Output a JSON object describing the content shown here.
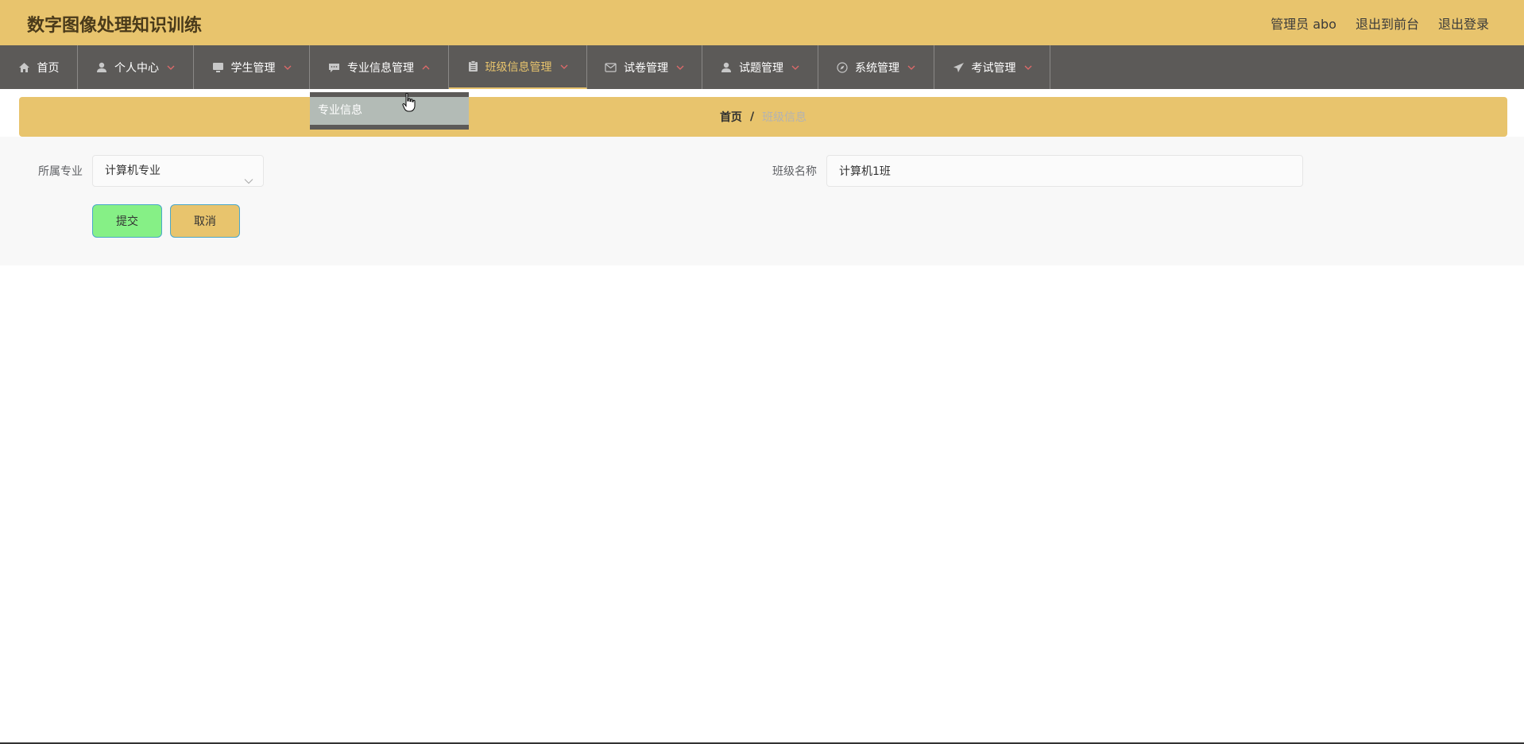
{
  "header": {
    "title": "数字图像处理知识训练",
    "links": [
      "管理员 abo",
      "退出到前台",
      "退出登录"
    ]
  },
  "nav": {
    "items": [
      {
        "label": "首页",
        "icon": "home-icon",
        "has_chevron": false
      },
      {
        "label": "个人中心",
        "icon": "user-icon",
        "has_chevron": true
      },
      {
        "label": "学生管理",
        "icon": "monitor-icon",
        "has_chevron": true
      },
      {
        "label": "专业信息管理",
        "icon": "chat-icon",
        "has_chevron": true,
        "expanded": true
      },
      {
        "label": "班级信息管理",
        "icon": "clipboard-icon",
        "has_chevron": true,
        "active": true
      },
      {
        "label": "试卷管理",
        "icon": "mail-icon",
        "has_chevron": true
      },
      {
        "label": "试题管理",
        "icon": "user-icon",
        "has_chevron": true
      },
      {
        "label": "系统管理",
        "icon": "compass-icon",
        "has_chevron": true
      },
      {
        "label": "考试管理",
        "icon": "send-icon",
        "has_chevron": true
      }
    ],
    "dropdown": {
      "items": [
        "专业信息"
      ]
    }
  },
  "breadcrumb": {
    "home": "首页",
    "separator": "/",
    "current": "班级信息"
  },
  "form": {
    "major_label": "所属专业",
    "major_value": "计算机专业",
    "class_label": "班级名称",
    "class_value": "计算机1班",
    "submit_label": "提交",
    "cancel_label": "取消"
  },
  "colors": {
    "accent": "#e8c46d",
    "nav_bg": "#5c5a58",
    "submit_bg": "#86f086"
  }
}
